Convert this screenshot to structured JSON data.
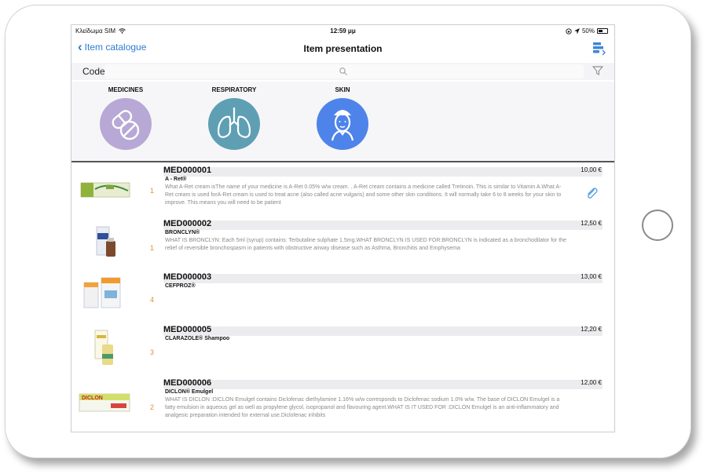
{
  "status_bar": {
    "carrier": "Κλείδωμα SIM",
    "time": "12:59 μμ",
    "battery": "50%",
    "battery_level": 0.5
  },
  "nav": {
    "back_label": "Item catalogue",
    "title": "Item presentation"
  },
  "search": {
    "code_label": "Code",
    "placeholder": ""
  },
  "categories": [
    {
      "label": "MEDICINES",
      "color": "#b7a8d6",
      "icon": "pills-icon"
    },
    {
      "label": "RESPIRATORY",
      "color": "#5f9fb4",
      "icon": "lungs-icon"
    },
    {
      "label": "SKIN",
      "color": "#4e84ea",
      "icon": "face-care-icon"
    }
  ],
  "items": [
    {
      "code": "MED000001",
      "name": "A - Ret®",
      "qty": "1",
      "price": "10,00 €",
      "description": "What A-Ret cream isThe name of your medicine is A-Ret 0.05% w/w cream. . A-Ret cream contains a medicine called Tretinoin. This is similar to Vitamin A.What A-Ret cream is used forA-Ret cream is used to treat acne (also called acne vulgaris) and some other skin conditions.          It will normally take 6 to 8 weeks for your skin to improve. This means you will need to be patient",
      "attachment": true
    },
    {
      "code": "MED000002",
      "name": "BRONCLYN®",
      "qty": "1",
      "price": "12,50 €",
      "description": "WHAT IS BRONCLYN: Each 5ml (syrup) contains: Terbutaline sulphate 1.5mg.WHAT BRONCLYN IS USED FOR:BRONCLYN  is indicated as a bronchodilator for the relief of reversible bronchospasm in patients with obstructive airway disease such as Asthma, Bronchitis and Emphysema",
      "attachment": false
    },
    {
      "code": "MED000003",
      "name": "CEFPROZ®",
      "qty": "4",
      "price": "13,00 €",
      "description": "",
      "attachment": false
    },
    {
      "code": "MED000005",
      "name": "CLARAZOLE® Shampoo",
      "qty": "3",
      "price": "12,20 €",
      "description": "",
      "attachment": false
    },
    {
      "code": "MED000006",
      "name": "DICLON® Emulgel",
      "qty": "2",
      "price": "12,00 €",
      "description": "WHAT IS DICLON :DICLON Emulgel contains Diclofenac diethylamine 1.16% w/w corresponds to Diclofenac sodium 1.0% w/w. The base of DICLON Emulgel is a fatty emulsion in aqueous gel as well as propylene glycol, isopropanol and flavouring agent.WHAT IS IT USED FOR :DICLON Emulgel is an anti-inflammatory and analgesic preparation intended for external use.Diclofenac inhibits",
      "attachment": false
    }
  ],
  "product_thumbs": {
    "diclon_box_text": "DICLON"
  }
}
